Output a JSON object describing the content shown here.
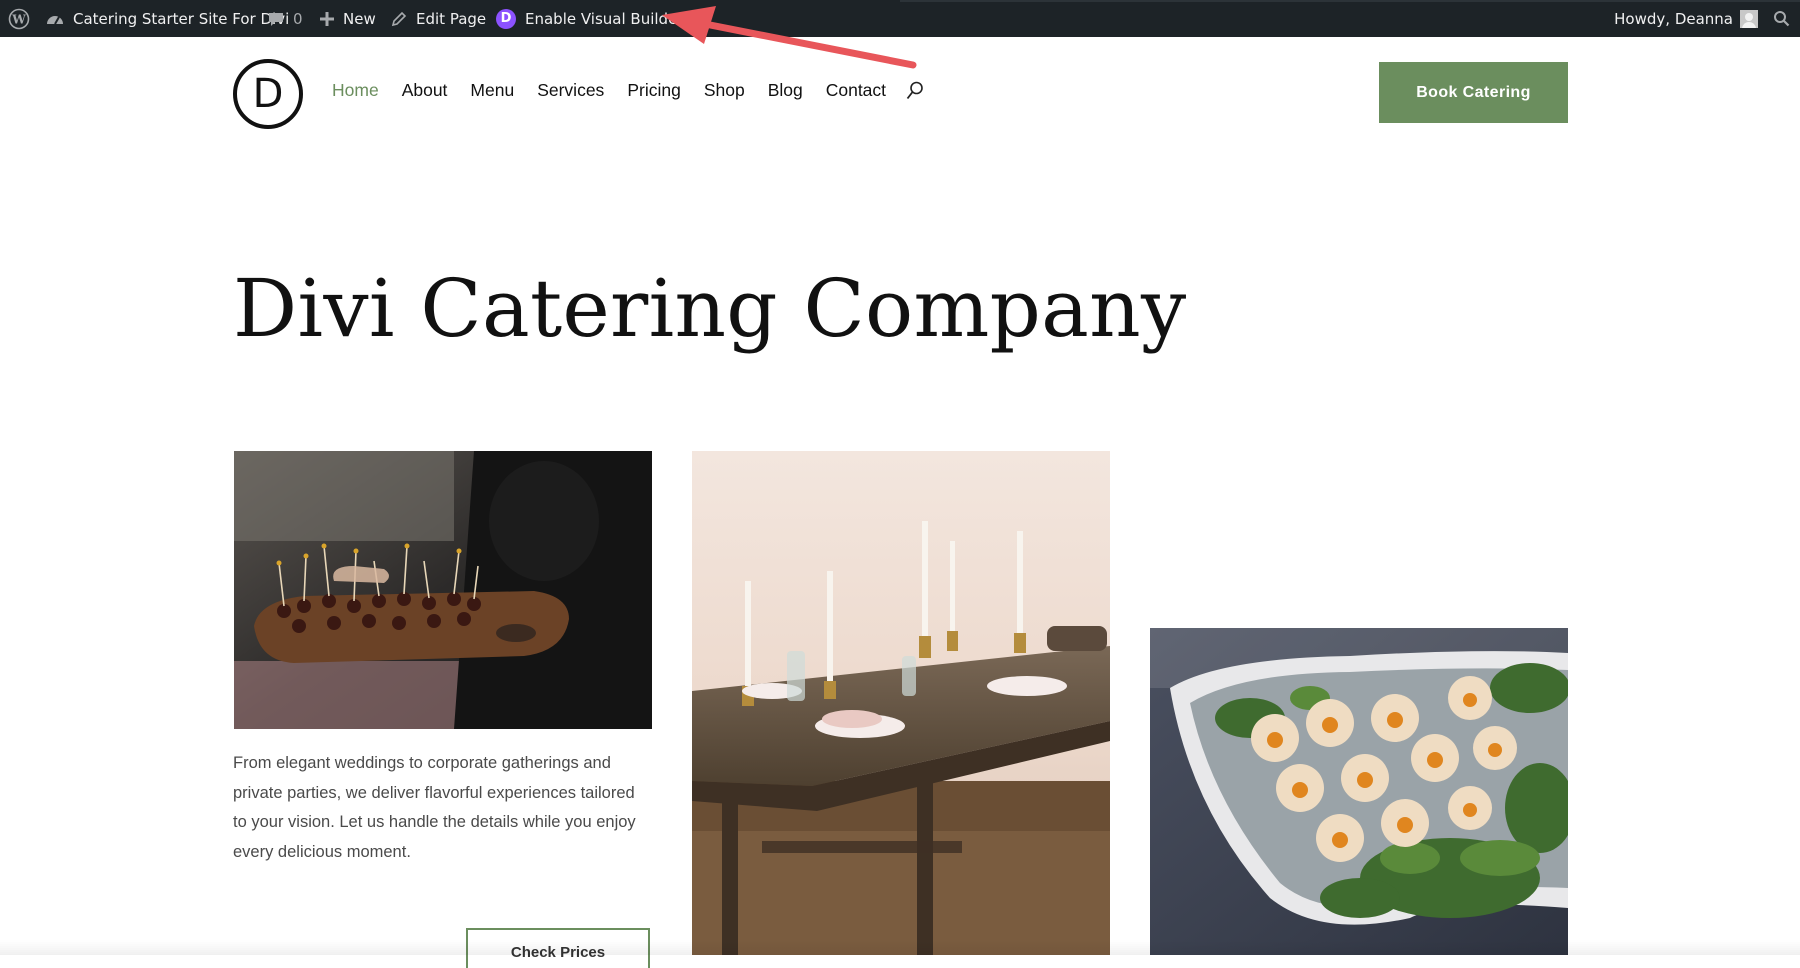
{
  "admin_bar": {
    "site_name": "Catering Starter Site For Divi",
    "comment_count": "0",
    "new_label": "New",
    "edit_page_label": "Edit Page",
    "divi_badge": "D",
    "visual_builder_label": "Enable Visual Builder",
    "greeting": "Howdy, Deanna",
    "icons": [
      "wordpress-icon",
      "dashboard-icon",
      "comment-icon",
      "plus-icon",
      "pencil-icon",
      "divi-icon",
      "avatar",
      "search-icon"
    ]
  },
  "header": {
    "logo_letter": "D",
    "nav": {
      "home": "Home",
      "about": "About",
      "menu": "Menu",
      "services": "Services",
      "pricing": "Pricing",
      "shop": "Shop",
      "blog": "Blog",
      "contact": "Contact"
    },
    "active_item": "Home",
    "cta_label": "Book Catering"
  },
  "hero": {
    "title": "Divi Catering Company",
    "description": "From elegant weddings to corporate gatherings and private parties, we deliver flavorful experiences tailored to your vision. Let us handle the details while you enjoy every delicious moment.",
    "button_label": "Check Prices"
  },
  "colors": {
    "admin_bar": "#1d2327",
    "accent_green": "#6b8e5e",
    "annotation_arrow": "#e8565a",
    "divi_purple": "#8c52ff"
  }
}
